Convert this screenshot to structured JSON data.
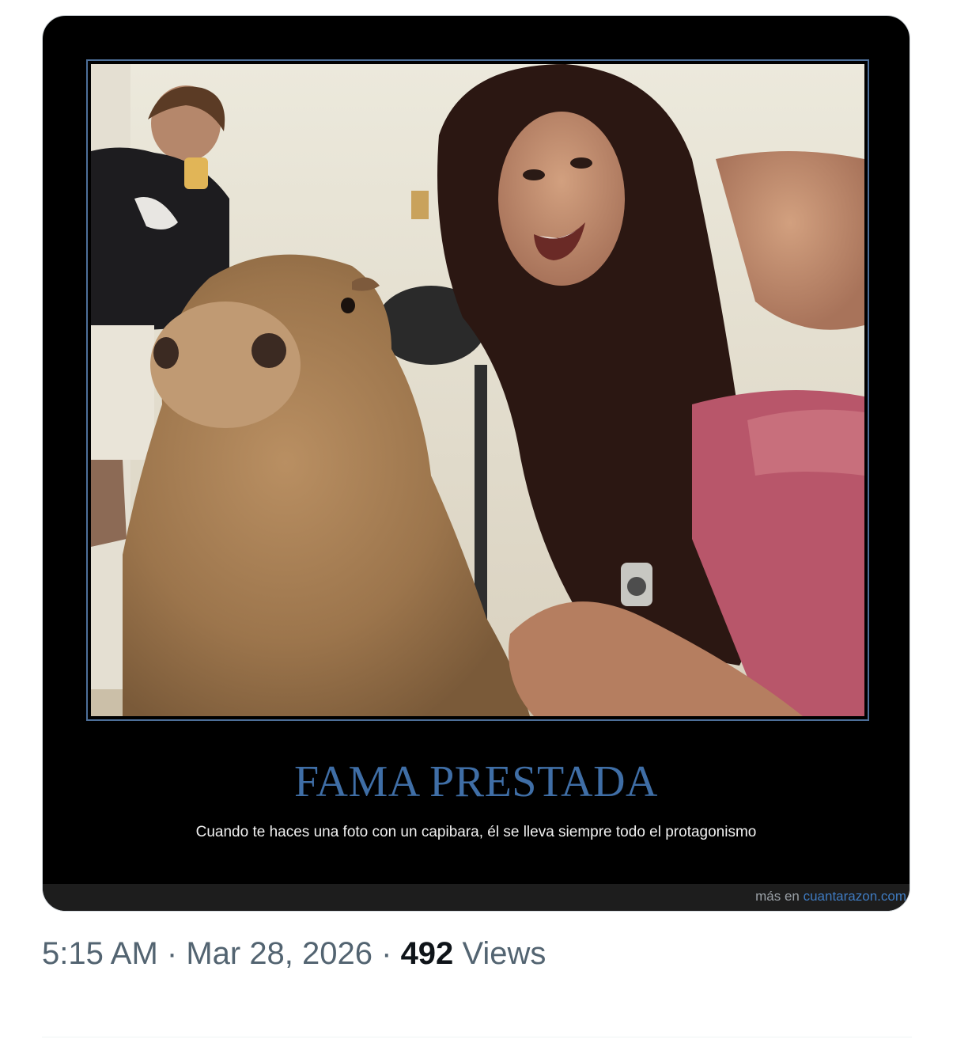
{
  "post": {
    "image_alt": "Capybara selfie with a woman",
    "poster": {
      "title": "FAMA PRESTADA",
      "caption": "Cuando te haces una foto con un capibara, él se lleva siempre todo el protagonismo",
      "watermark_prefix": "más en ",
      "watermark_site": "cuantarazon.com"
    },
    "meta": {
      "time": "5:15 AM",
      "separator": " · ",
      "date": "Mar 28, 2026",
      "views_count": "492",
      "views_label": "Views"
    }
  },
  "colors": {
    "poster_background": "#000000",
    "title_blue": "#3f6ea6",
    "meta_gray": "#536471",
    "text_dark": "#0f1419"
  }
}
